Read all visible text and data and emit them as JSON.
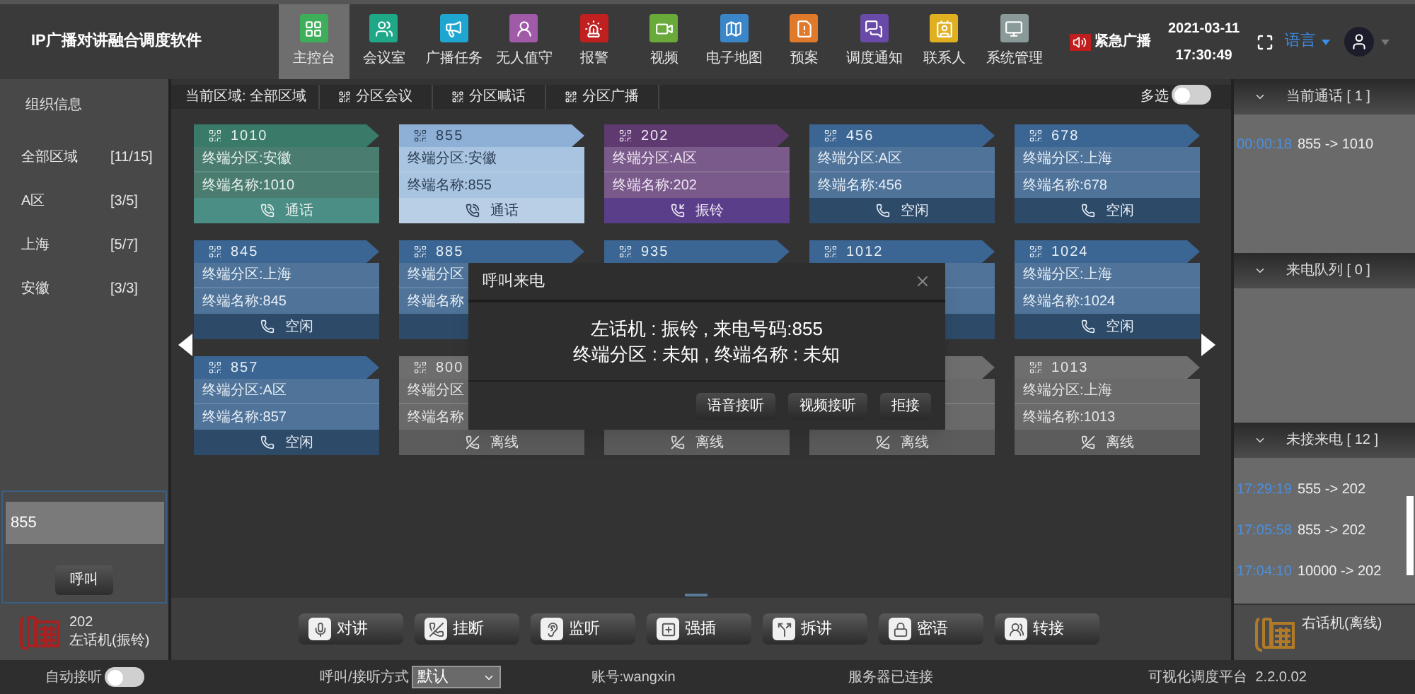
{
  "app_title": "IP广播对讲融合调度软件",
  "nav": [
    {
      "label": "主控台",
      "selected": true
    },
    {
      "label": "会议室",
      "selected": false
    },
    {
      "label": "广播任务",
      "selected": false
    },
    {
      "label": "无人值守",
      "selected": false
    },
    {
      "label": "报警",
      "selected": false
    },
    {
      "label": "视频",
      "selected": false
    },
    {
      "label": "电子地图",
      "selected": false
    },
    {
      "label": "预案",
      "selected": false
    },
    {
      "label": "调度通知",
      "selected": false
    },
    {
      "label": "联系人",
      "selected": false
    },
    {
      "label": "系统管理",
      "selected": false
    }
  ],
  "emergency_broadcast": "紧急广播",
  "date": "2021-03-11",
  "time": "17:30:49",
  "language": "语言",
  "sidebar": {
    "title": "组织信息",
    "areas": [
      {
        "name": "全部区域",
        "count": "[11/15]"
      },
      {
        "name": "A区",
        "count": "[3/5]"
      },
      {
        "name": "上海",
        "count": "[5/7]"
      },
      {
        "name": "安徽",
        "count": "[3/3]"
      }
    ],
    "dial": {
      "value": "855",
      "button": "呼叫"
    },
    "phone": {
      "number": "202",
      "status": "左话机(振铃)",
      "ringing": true
    }
  },
  "area_bar": {
    "current": "当前区域: 全部区域",
    "actions": [
      "分区会议",
      "分区喊话",
      "分区广播"
    ],
    "multi_select": {
      "label": "多选",
      "on": false
    }
  },
  "terminals": [
    {
      "kind": "talking",
      "selected": false,
      "id": "1010",
      "zone": "终端分区:安徽",
      "name": "终端名称:1010",
      "status": "通话"
    },
    {
      "kind": "talking",
      "selected": true,
      "id": "855",
      "zone": "终端分区:安徽",
      "name": "终端名称:855",
      "status": "通话"
    },
    {
      "kind": "ringing",
      "selected": false,
      "id": "202",
      "zone": "终端分区:A区",
      "name": "终端名称:202",
      "status": "振铃"
    },
    {
      "kind": "idle",
      "selected": false,
      "id": "456",
      "zone": "终端分区:A区",
      "name": "终端名称:456",
      "status": "空闲"
    },
    {
      "kind": "idle",
      "selected": false,
      "id": "678",
      "zone": "终端分区:上海",
      "name": "终端名称:678",
      "status": "空闲"
    },
    {
      "kind": "idle",
      "selected": false,
      "id": "845",
      "zone": "终端分区:上海",
      "name": "终端名称:845",
      "status": "空闲"
    },
    {
      "kind": "idle",
      "selected": false,
      "id": "885",
      "zone": "终端分区",
      "name": "终端名称"
    },
    {
      "kind": "idle",
      "selected": false,
      "id": "935"
    },
    {
      "kind": "idle",
      "selected": false,
      "id": "1012"
    },
    {
      "kind": "idle",
      "selected": false,
      "id": "1024",
      "zone": "终端分区:上海",
      "name": "终端名称:1024",
      "status": "空闲"
    },
    {
      "kind": "idle",
      "selected": false,
      "id": "857",
      "zone": "终端分区:A区",
      "name": "终端名称:857",
      "status": "空闲"
    },
    {
      "kind": "offline",
      "selected": false,
      "id": "800",
      "zone": "终端分区",
      "name": "终端名称",
      "status": "离线"
    },
    {
      "kind": "offline",
      "selected": false,
      "status": "离线"
    },
    {
      "kind": "offline",
      "selected": false,
      "status": "离线"
    },
    {
      "kind": "offline",
      "selected": false,
      "id": "1013",
      "zone": "终端分区:上海",
      "name": "终端名称:1013",
      "status": "离线"
    }
  ],
  "dialog": {
    "title": "呼叫来电",
    "lines": [
      "左话机 : 振铃 , 来电号码:855",
      "终端分区 : 未知 , 终端名称 : 未知"
    ],
    "buttons": [
      "语音接听",
      "视频接听",
      "拒接"
    ]
  },
  "actions": [
    "对讲",
    "挂断",
    "监听",
    "强插",
    "拆讲",
    "密语",
    "转接"
  ],
  "right_panel": {
    "current_calls": {
      "title": "当前通话 [ 1 ]",
      "items": [
        {
          "time": "00:00:18",
          "call": "855 -> 1010"
        }
      ]
    },
    "queue": {
      "title": "来电队列 [ 0 ]"
    },
    "missed": {
      "title": "未接来电 [ 12 ]",
      "items": [
        {
          "time": "17:29:19",
          "call": "555 -> 202"
        },
        {
          "time": "17:05:58",
          "call": "855 -> 202"
        },
        {
          "time": "17:04:10",
          "call": "10000 -> 202"
        }
      ]
    },
    "phone": {
      "status": "右话机(离线)",
      "ringing": false
    }
  },
  "status_bar": {
    "auto_answer": {
      "label": "自动接听",
      "on": false
    },
    "mode_label": "呼叫/接听方式",
    "mode": "默认",
    "account": "账号:wangxin",
    "server": "服务器已连接",
    "platform": "可视化调度平台",
    "version": "2.2.0.02"
  }
}
